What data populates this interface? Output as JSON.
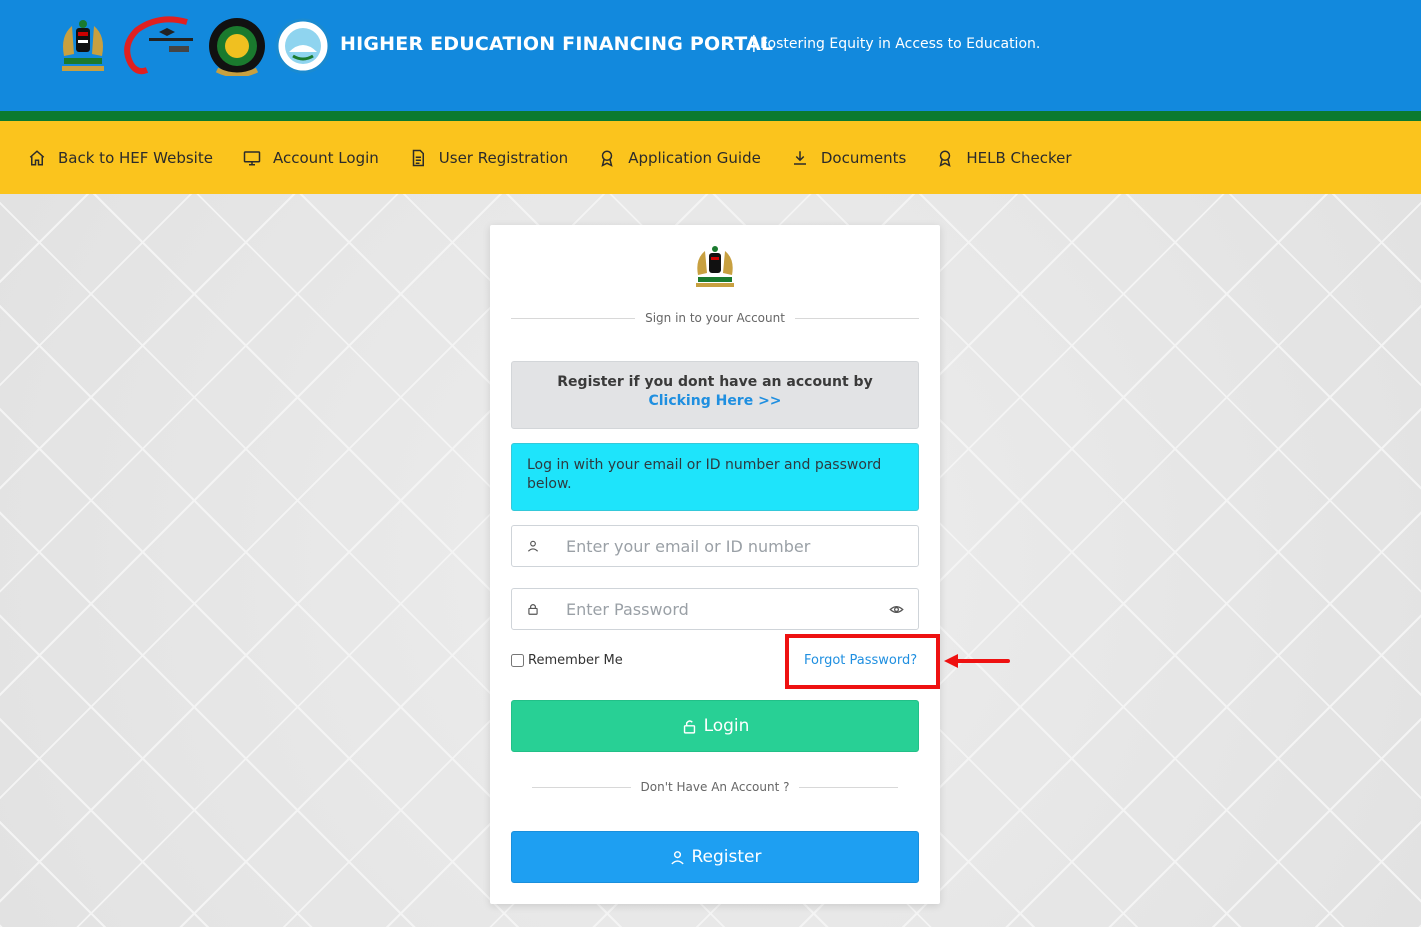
{
  "header": {
    "title": "HIGHER EDUCATION FINANCING PORTAL",
    "separator": "|",
    "tagline": "Fostering Equity in Access to Education.",
    "logos": [
      "kenya-coat-of-arms-logo",
      "university-fund-logo",
      "helb-logo",
      "kenya-rural-logo"
    ]
  },
  "nav": {
    "items": [
      {
        "label": "Back to HEF Website",
        "icon": "home-icon"
      },
      {
        "label": "Account Login",
        "icon": "monitor-icon"
      },
      {
        "label": "User Registration",
        "icon": "document-icon"
      },
      {
        "label": "Application Guide",
        "icon": "award-icon"
      },
      {
        "label": "Documents",
        "icon": "download-icon"
      },
      {
        "label": "HELB Checker",
        "icon": "award-icon"
      }
    ]
  },
  "card": {
    "subtitle": "Sign in to your Account",
    "register_notice": "Register if you dont have an account by ",
    "register_link": "Clicking Here >>",
    "login_info": "Log in with your email or ID number and password below.",
    "email_placeholder": "Enter your email or ID number",
    "password_placeholder": "Enter Password",
    "remember_label": "Remember Me",
    "forgot_label": "Forgot Password?",
    "login_button": "Login",
    "no_account": "Don't Have An Account ?",
    "register_button": "Register"
  },
  "colors": {
    "header_blue": "#1289dd",
    "green_band": "#0b7a2e",
    "nav_yellow": "#fbc41d",
    "login_green": "#28d095",
    "register_blue": "#1e9ff2",
    "info_cyan": "#1ee4fb",
    "highlight_red": "#ee1111"
  }
}
